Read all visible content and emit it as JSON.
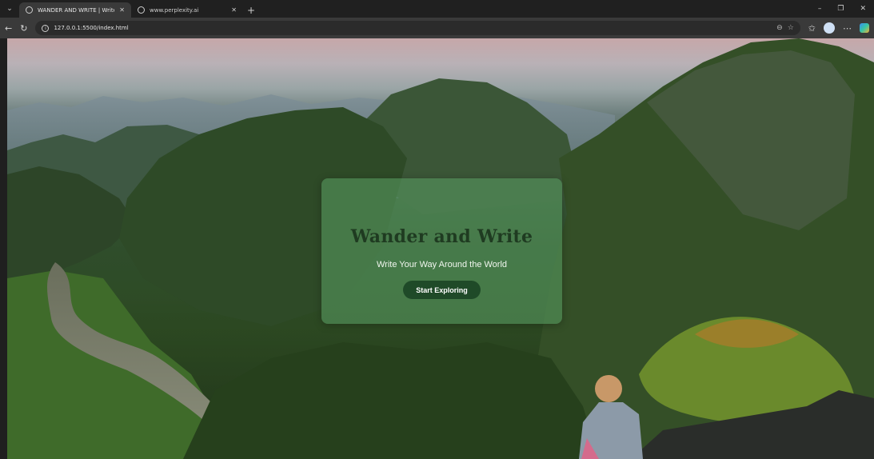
{
  "browser": {
    "tabs": [
      {
        "title": "WANDER AND WRITE | Write Your",
        "active": true
      },
      {
        "title": "www.perplexity.ai",
        "active": false
      }
    ],
    "address": {
      "url": "127.0.0.1:5500/index.html"
    },
    "window_controls": {
      "minimize": "–",
      "restore": "❐",
      "close": "✕"
    }
  },
  "hero": {
    "title": "Wander and Write",
    "subtitle": "Write Your Way Around the World",
    "cta_label": "Start Exploring"
  },
  "colors": {
    "card_bg": "#56965e",
    "title_color": "#1f3b21",
    "button_bg": "#1f4a28"
  }
}
